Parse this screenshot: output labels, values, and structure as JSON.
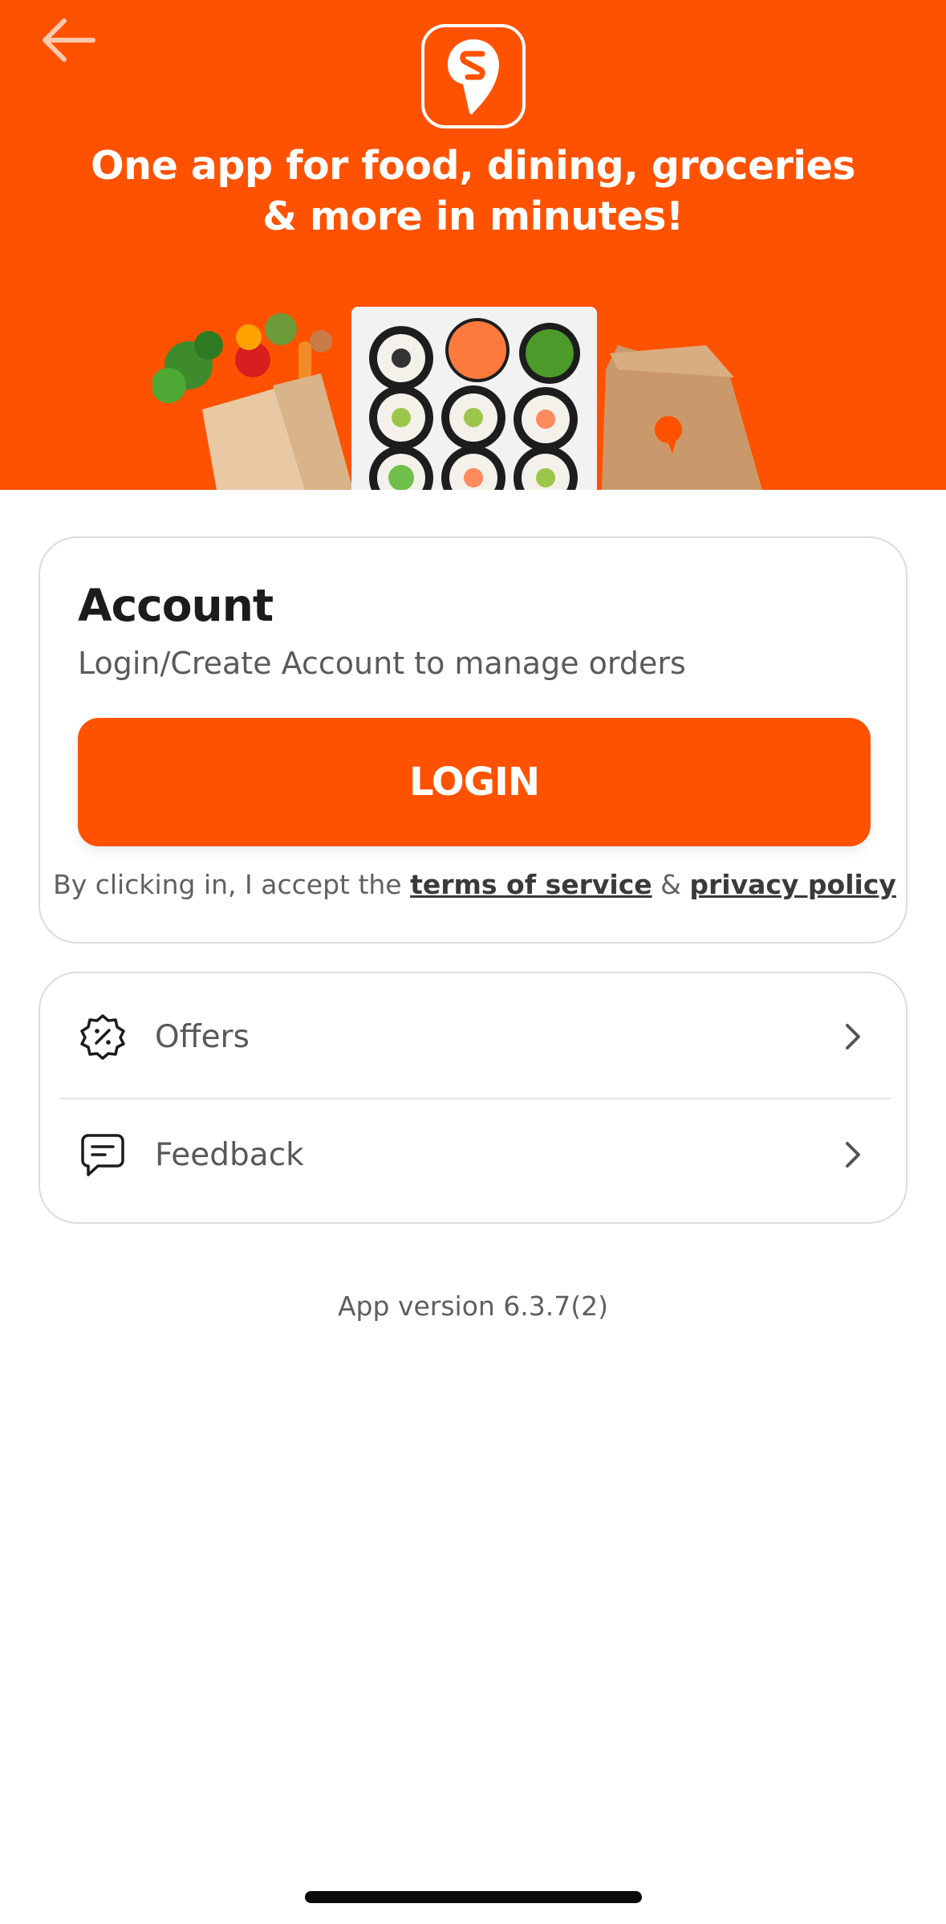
{
  "colors": {
    "brand": "#FF5200",
    "text_dark": "#1c1c1c",
    "text_muted": "#5a5a5a",
    "border": "#dcdcdc"
  },
  "header": {
    "back_icon": "arrow-left-icon",
    "logo_icon": "swiggy-logo",
    "tagline_line1": "One app for food, dining, groceries",
    "tagline_line2": "& more in minutes!"
  },
  "account": {
    "title": "Account",
    "subtitle": "Login/Create Account to manage orders",
    "login_label": "LOGIN",
    "terms_prefix": "By clicking in, I accept the",
    "terms_link": "terms of service",
    "terms_and": "&",
    "privacy_link": "privacy policy"
  },
  "menu": {
    "items": [
      {
        "label": "Offers",
        "icon": "offer-badge-icon"
      },
      {
        "label": "Feedback",
        "icon": "feedback-icon"
      }
    ]
  },
  "footer": {
    "version": "App version 6.3.7(2)"
  }
}
